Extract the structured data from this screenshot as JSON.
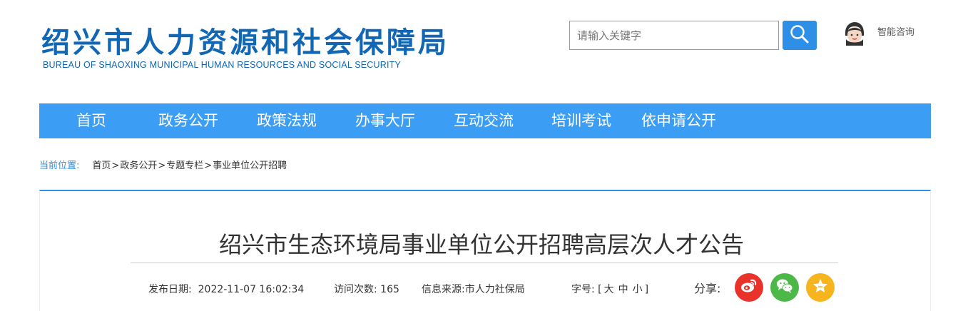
{
  "header": {
    "logo_cn": "绍兴市人力资源和社会保障局",
    "logo_en": "BUREAU OF SHAOXING MUNICIPAL HUMAN RESOURCES AND SOCIAL SECURITY",
    "search_placeholder": "请输入关键字",
    "consult_label": "智能咨询"
  },
  "nav": {
    "items": [
      "首页",
      "政务公开",
      "政策法规",
      "办事大厅",
      "互动交流",
      "培训考试",
      "依申请公开"
    ]
  },
  "breadcrumb": {
    "label": "当前位置:",
    "items": [
      "首页",
      "政务公开",
      "专题专栏",
      "事业单位公开招聘"
    ],
    "separator": ">"
  },
  "article": {
    "title": "绍兴市生态环境局事业单位公开招聘高层次人才公告",
    "publish_date_label": "发布日期:",
    "publish_date": "2022-11-07 16:02:34",
    "visits": "访问次数: 165",
    "source": "信息来源:市人力社保局",
    "font_size_label": "字号:",
    "font_size_open": "[",
    "font_sizes": [
      "大",
      "中",
      "小"
    ],
    "font_size_close": "]",
    "share_label": "分享:"
  },
  "colors": {
    "brand_blue": "#1167b4",
    "nav_blue": "#3b9ef4",
    "weibo_red": "#e8322a",
    "wechat_green": "#4cb848",
    "favorite_yellow": "#f6b51e"
  },
  "icons": {
    "search": "search-icon",
    "consult": "customer-service-avatar-icon",
    "share": [
      "weibo-icon",
      "wechat-icon",
      "favorite-star-icon"
    ]
  }
}
